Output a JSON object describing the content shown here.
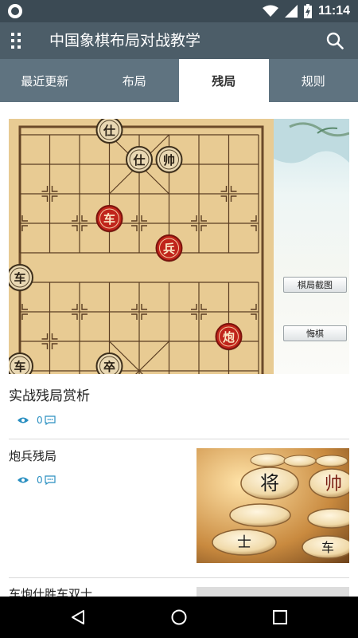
{
  "status_bar": {
    "time": "11:14"
  },
  "app_bar": {
    "title": "中国象棋布局对战教学"
  },
  "tabs": [
    {
      "label": "最近更新",
      "active": false
    },
    {
      "label": "布局",
      "active": false
    },
    {
      "label": "残局",
      "active": true
    },
    {
      "label": "规则",
      "active": false
    }
  ],
  "featured": {
    "title": "实战残局赏析",
    "views": "0",
    "side_buttons": [
      "棋局截图",
      "悔棋"
    ],
    "pieces": [
      {
        "char": "仕",
        "side": "black"
      },
      {
        "char": "仕",
        "side": "black"
      },
      {
        "char": "帅",
        "side": "black"
      },
      {
        "char": "车",
        "side": "red"
      },
      {
        "char": "兵",
        "side": "red"
      },
      {
        "char": "车",
        "side": "black"
      },
      {
        "char": "炮",
        "side": "red"
      },
      {
        "char": "车",
        "side": "black"
      },
      {
        "char": "卒",
        "side": "black"
      }
    ]
  },
  "list": [
    {
      "title": "炮兵残局",
      "views": "0",
      "thumb_pieces": [
        "将",
        "帅",
        "士",
        "车"
      ]
    },
    {
      "title": "车炮仕胜车双士"
    }
  ],
  "colors": {
    "status": "#3b4a54",
    "appbar": "#4c5d68",
    "tabs": "#5f7380",
    "accent": "#2a8fc1",
    "red_piece": "#c0241b"
  }
}
